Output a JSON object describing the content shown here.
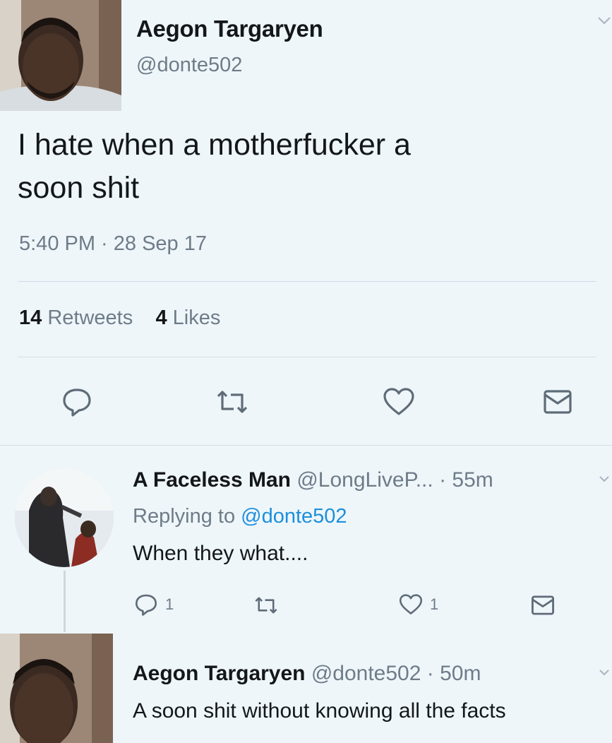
{
  "main_tweet": {
    "name": "Aegon Targaryen",
    "handle": "@donte502",
    "text_line1": "I hate when a motherfucker a",
    "text_line2": "soon shit",
    "timestamp": "5:40 PM · 28 Sep 17",
    "retweets_count": "14",
    "retweets_label": "Retweets",
    "likes_count": "4",
    "likes_label": "Likes",
    "actions": [
      {
        "icon": "reply-icon"
      },
      {
        "icon": "retweet-icon"
      },
      {
        "icon": "heart-icon"
      },
      {
        "icon": "message-icon"
      }
    ]
  },
  "reply": {
    "name": "A Faceless Man",
    "handle": "@LongLiveP...",
    "time": "· 55m",
    "replying_prefix": "Replying to",
    "replying_mention": "@donte502",
    "text": "When they what....",
    "reply_count": "1",
    "like_count": "1"
  },
  "bottom_tweet": {
    "name": "Aegon Targaryen",
    "handle": "@donte502",
    "time": "· 50m",
    "text": "A soon shit without knowing all the facts"
  },
  "colors": {
    "background": "#eef6fa",
    "text": "#14171a",
    "secondary": "#6e7c88",
    "mention": "#1d8fdb"
  }
}
